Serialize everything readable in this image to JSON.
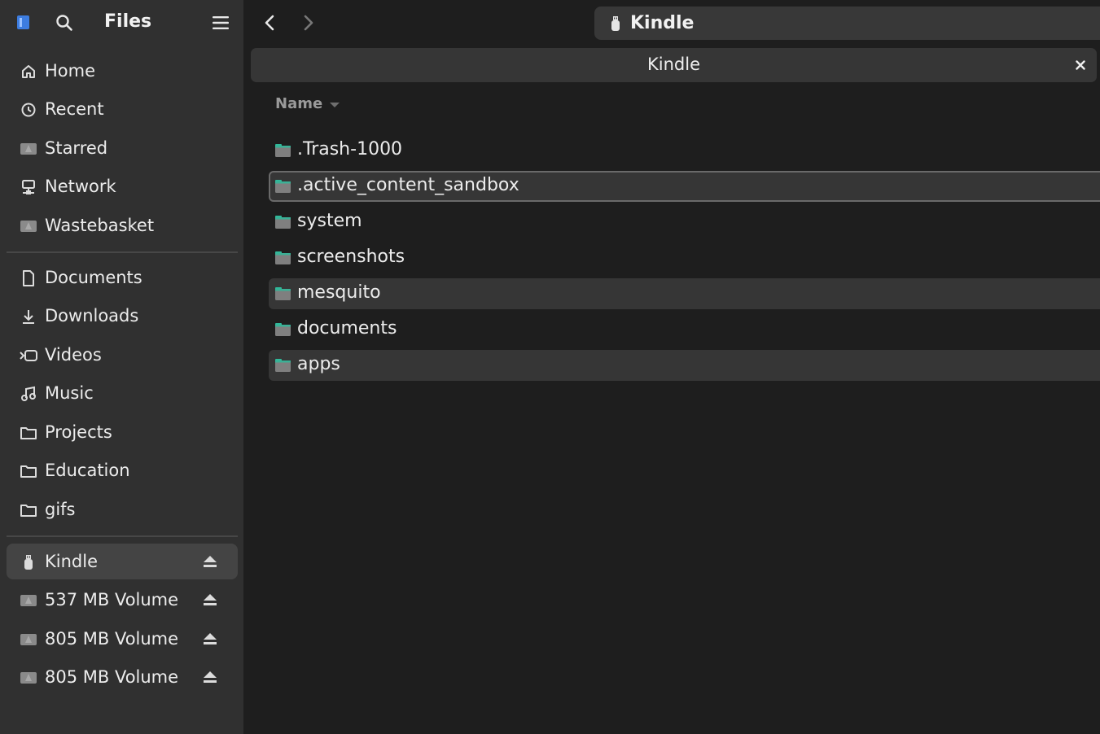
{
  "app": {
    "title": "Files"
  },
  "sidebar": {
    "places": [
      {
        "label": "Home",
        "icon": "home-icon"
      },
      {
        "label": "Recent",
        "icon": "clock-icon"
      },
      {
        "label": "Starred",
        "icon": "drive-icon"
      },
      {
        "label": "Network",
        "icon": "network-icon"
      },
      {
        "label": "Wastebasket",
        "icon": "drive-icon"
      }
    ],
    "bookmarks": [
      {
        "label": "Documents",
        "icon": "document-icon"
      },
      {
        "label": "Downloads",
        "icon": "download-icon"
      },
      {
        "label": "Videos",
        "icon": "video-icon"
      },
      {
        "label": "Music",
        "icon": "music-icon"
      },
      {
        "label": "Projects",
        "icon": "folder-outline-icon"
      },
      {
        "label": "Education",
        "icon": "folder-outline-icon"
      },
      {
        "label": "gifs",
        "icon": "folder-outline-icon"
      }
    ],
    "devices": [
      {
        "label": "Kindle",
        "icon": "usb-icon",
        "active": true
      },
      {
        "label": "537 MB Volume",
        "icon": "drive-icon"
      },
      {
        "label": "805 MB Volume",
        "icon": "drive-icon"
      },
      {
        "label": "805 MB Volume",
        "icon": "drive-icon"
      }
    ]
  },
  "toolbar": {
    "path_label": "Kindle"
  },
  "tab": {
    "title": "Kindle"
  },
  "list": {
    "column_header": "Name",
    "rows": [
      {
        "name": ".Trash-1000",
        "state": "normal"
      },
      {
        "name": ".active_content_sandbox",
        "state": "focused"
      },
      {
        "name": "system",
        "state": "normal"
      },
      {
        "name": "screenshots",
        "state": "normal"
      },
      {
        "name": "mesquito",
        "state": "selected"
      },
      {
        "name": "documents",
        "state": "normal"
      },
      {
        "name": "apps",
        "state": "selected"
      }
    ]
  },
  "colors": {
    "sidebar_bg": "#303030",
    "main_bg": "#1e1e1e",
    "folder_body": "#7f7f7f",
    "folder_tab": "#2fb99a",
    "selected_row": "#363636"
  }
}
